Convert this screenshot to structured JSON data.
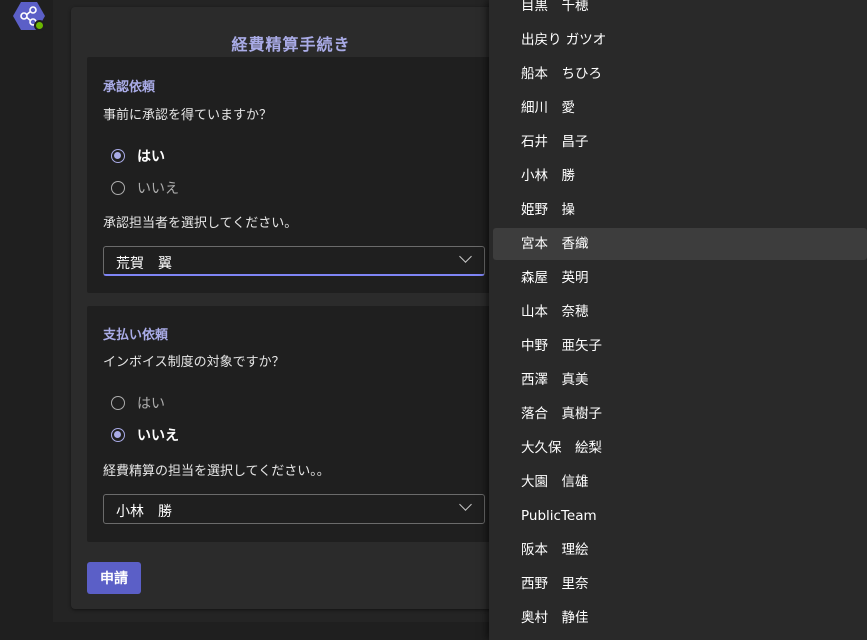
{
  "app": {
    "icon": "share-hub-icon",
    "presence": "available",
    "accent": "#a9abe6",
    "brand": "#5b5fc7"
  },
  "form": {
    "title": "経費精算手続き",
    "approval": {
      "heading": "承認依頼",
      "question": "事前に承認を得ていますか？",
      "options": [
        "はい",
        "いいえ"
      ],
      "selected": "はい",
      "approver_label": "承認担当者を選択してください。",
      "approver_value": "荒賀　翼"
    },
    "payment": {
      "heading": "支払い依頼",
      "question": "インボイス制度の対象ですか？",
      "options": [
        "はい",
        "いいえ"
      ],
      "selected": "いいえ",
      "assignee_label": "経費精算の担当を選択してください。。",
      "assignee_value": "小林　勝"
    },
    "submit_label": "申請"
  },
  "dropdown": {
    "items": [
      "目黒　千穂",
      "出戻り ガツオ",
      "船本　ちひろ",
      "細川　愛",
      "石井　昌子",
      "小林　勝",
      "姫野　操",
      "宮本　香織",
      "森屋　英明",
      "山本　奈穂",
      "中野　亜矢子",
      "西澤　真美",
      "落合　真樹子",
      "大久保　絵梨",
      "大園　信雄",
      "PublicTeam",
      "阪本　理絵",
      "西野　里奈",
      "奥村　静佳"
    ],
    "hovered": "宮本　香織"
  }
}
